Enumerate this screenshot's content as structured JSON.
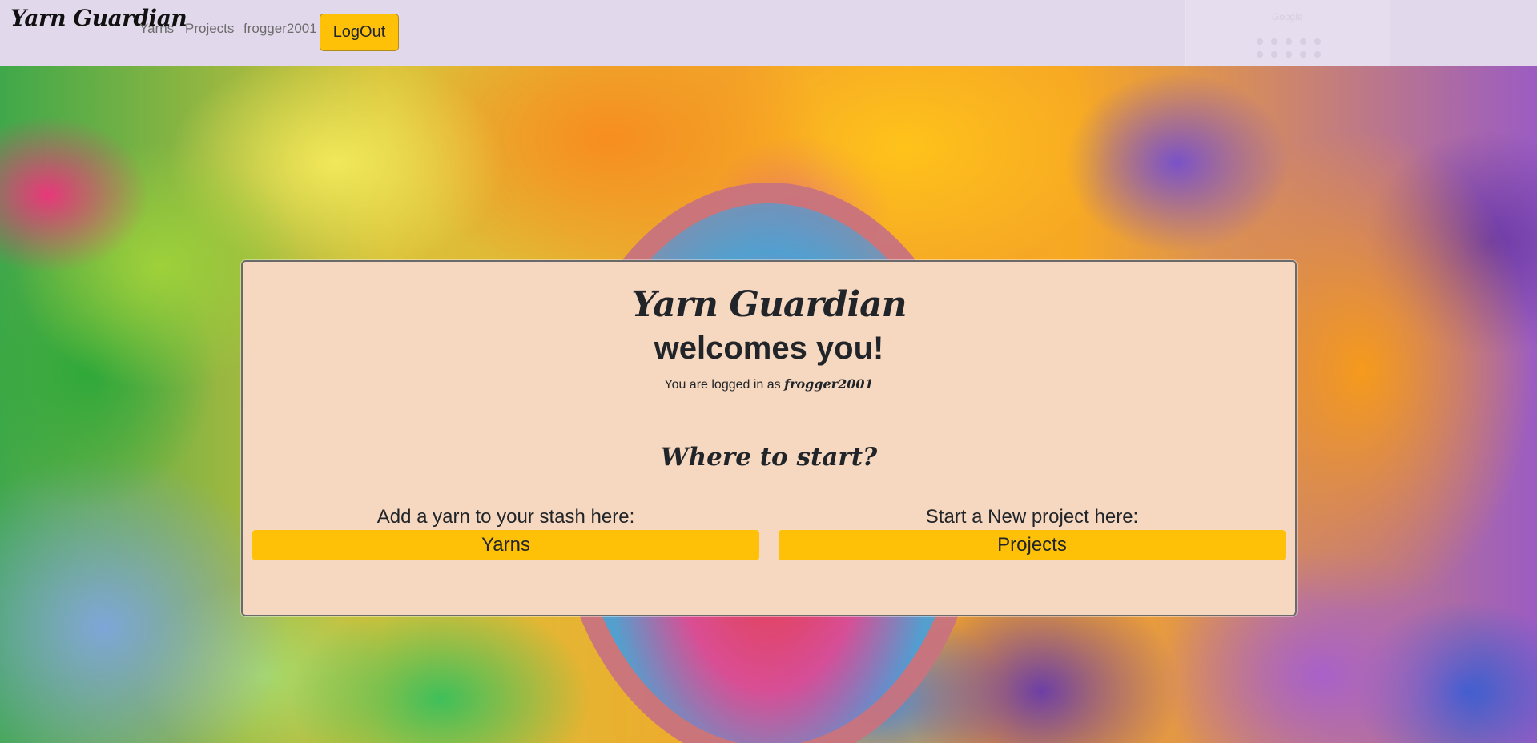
{
  "navbar": {
    "brand": "Yarn Guardian",
    "links": {
      "yarns": "Yarns",
      "projects": "Projects",
      "user": "frogger2001"
    },
    "logout_label": "LogOut",
    "ghost_widget_label": "Google"
  },
  "card": {
    "title": "Yarn Guardian",
    "subtitle": "welcomes you!",
    "logged_in_prefix": "You are logged in as",
    "logged_in_user": "frogger2001",
    "where_heading": "Where to start?",
    "left": {
      "label": "Add a yarn to your stash here:",
      "button": "Yarns"
    },
    "right": {
      "label": "Start a New project here:",
      "button": "Projects"
    }
  },
  "colors": {
    "navbar_bg": "#e2d8ec",
    "card_bg": "#f6d7bf",
    "accent_button": "#ffc107"
  },
  "icons": [
    "ghost-dots-icon"
  ]
}
